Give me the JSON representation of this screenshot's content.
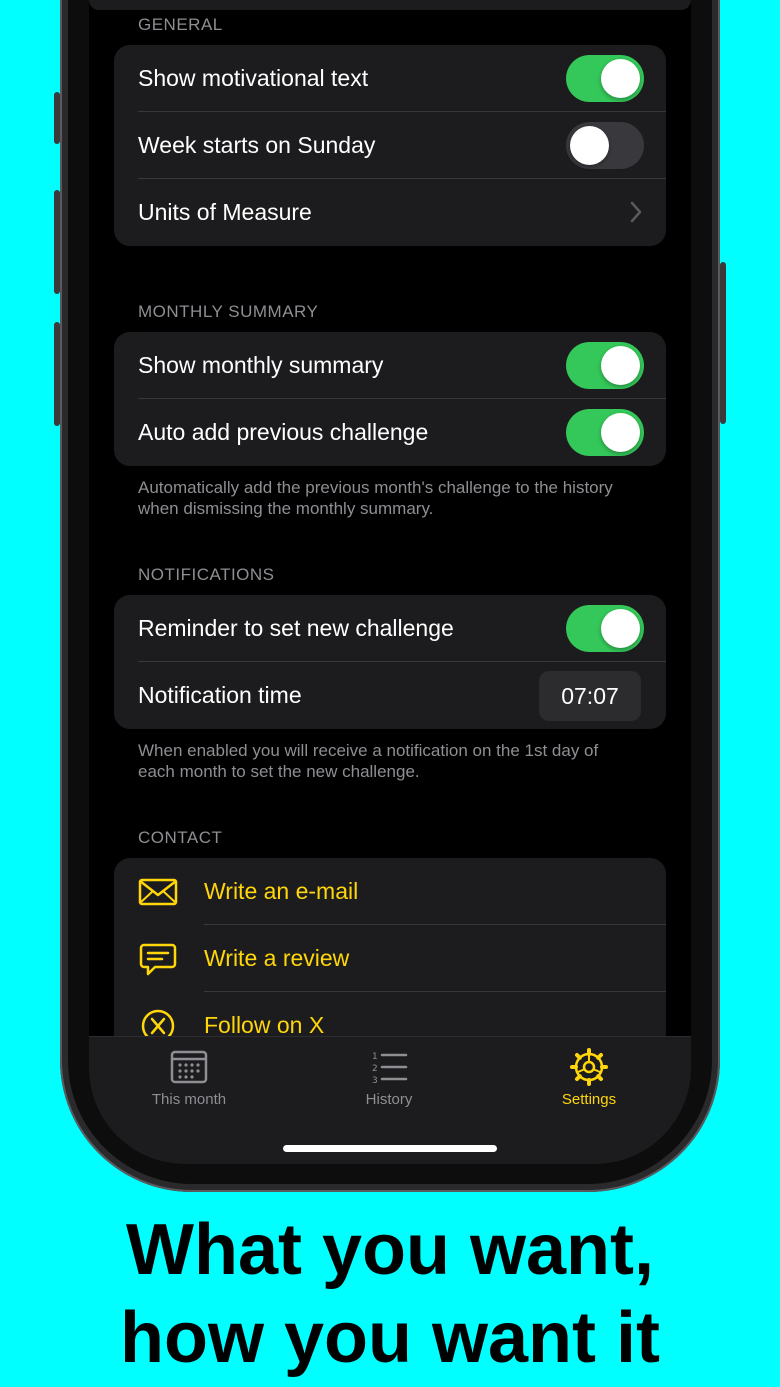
{
  "general": {
    "header": "GENERAL",
    "rows": [
      {
        "label": "Show motivational text",
        "toggle": true
      },
      {
        "label": "Week starts on Sunday",
        "toggle": false
      },
      {
        "label": "Units of Measure"
      }
    ]
  },
  "monthly_summary": {
    "header": "MONTHLY SUMMARY",
    "rows": [
      {
        "label": "Show monthly summary",
        "toggle": true
      },
      {
        "label": "Auto add previous challenge",
        "toggle": true
      }
    ],
    "footnote": "Automatically add the previous month's challenge to the history when dismissing the monthly summary."
  },
  "notifications": {
    "header": "NOTIFICATIONS",
    "rows": [
      {
        "label": "Reminder to set new challenge",
        "toggle": true
      },
      {
        "label": "Notification time",
        "value": "07:07"
      }
    ],
    "footnote": "When enabled you will receive a notification on the 1st day of each month to set the new challenge."
  },
  "contact": {
    "header": "CONTACT",
    "rows": [
      {
        "label": "Write an e-mail",
        "icon": "envelope-icon"
      },
      {
        "label": "Write a review",
        "icon": "speech-bubble-icon"
      },
      {
        "label": "Follow on X",
        "icon": "x-circle-icon"
      }
    ]
  },
  "tabbar": {
    "tabs": [
      {
        "label": "This month",
        "icon": "calendar-icon",
        "active": false
      },
      {
        "label": "History",
        "icon": "numbered-list-icon",
        "active": false
      },
      {
        "label": "Settings",
        "icon": "gear-icon",
        "active": true
      }
    ]
  },
  "colors": {
    "accent": "#FFD60A",
    "toggle_on": "#34C759",
    "background": "#00FFFF"
  },
  "tagline": {
    "line1": "What you want,",
    "line2": "how you want it"
  }
}
